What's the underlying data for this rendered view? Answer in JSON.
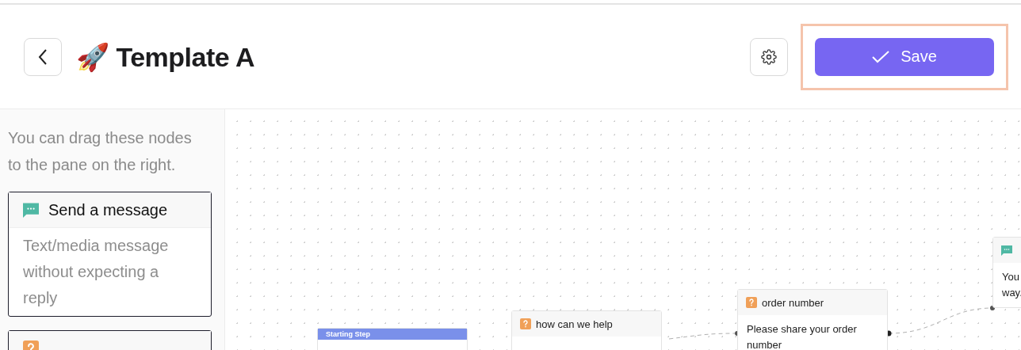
{
  "header": {
    "title_emoji": "🚀",
    "title": "Template A",
    "save": "Save"
  },
  "sidebar": {
    "hint": "You can drag these nodes to the pane on the right.",
    "nodes": [
      {
        "kind": "message",
        "title": "Send a message",
        "description": "Text/media message without expecting a reply"
      },
      {
        "kind": "question"
      }
    ]
  },
  "canvas": {
    "nodes": [
      {
        "kind": "start",
        "title": "Starting Step"
      },
      {
        "kind": "question",
        "title": "how can we help"
      },
      {
        "kind": "question",
        "title": "order number",
        "lines": [
          "Please share your order",
          "number"
        ]
      },
      {
        "kind": "message",
        "lines": [
          "You",
          "way."
        ]
      }
    ]
  }
}
